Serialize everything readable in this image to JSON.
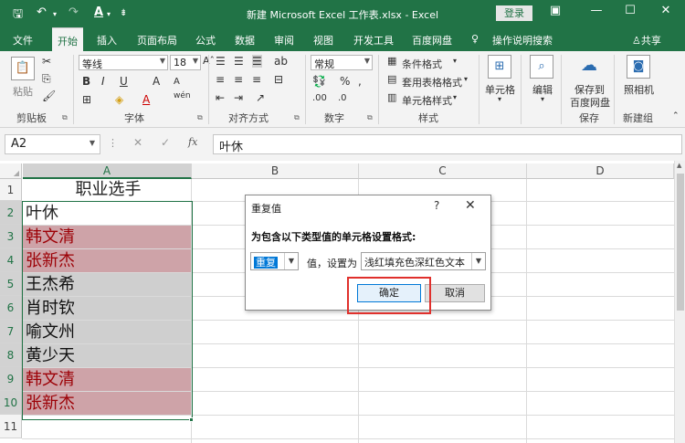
{
  "titlebar": {
    "title": "新建 Microsoft Excel 工作表.xlsx - Excel",
    "login": "登录",
    "save_icon": "save-icon",
    "undo_icon": "undo-icon",
    "redo_icon": "redo-icon",
    "font_color_quick_icon": "font-color-icon"
  },
  "menu_tabs": [
    "文件",
    "开始",
    "插入",
    "页面布局",
    "公式",
    "数据",
    "审阅",
    "视图",
    "开发工具",
    "百度网盘"
  ],
  "tellme": "操作说明搜索",
  "share": "共享",
  "ribbon": {
    "clipboard": {
      "label": "剪贴板",
      "paste": "粘贴"
    },
    "font": {
      "label": "字体",
      "font_name": "等线",
      "font_size": "18",
      "bold": "B",
      "italic": "I",
      "underline": "U",
      "wen": "wén"
    },
    "alignment": {
      "label": "对齐方式"
    },
    "number": {
      "label": "数字",
      "format": "常规"
    },
    "styles": {
      "label": "样式",
      "conditional": "条件格式",
      "table": "套用表格格式",
      "cell": "单元格样式"
    },
    "cells": {
      "label": "单元格"
    },
    "editing": {
      "label": "编辑"
    },
    "save": {
      "label": "保存",
      "button_line1": "保存到",
      "button_line2": "百度网盘"
    },
    "newgroup": {
      "label": "新建组",
      "camera": "照相机"
    }
  },
  "formula_bar": {
    "name_box": "A2",
    "fx": "fx",
    "value": "叶休"
  },
  "columns": [
    "A",
    "B",
    "C",
    "D"
  ],
  "rows": [
    {
      "num": "1",
      "value": "职业选手",
      "style": "header"
    },
    {
      "num": "2",
      "value": "叶休",
      "style": "plain"
    },
    {
      "num": "3",
      "value": "韩文清",
      "style": "red"
    },
    {
      "num": "4",
      "value": "张新杰",
      "style": "red"
    },
    {
      "num": "5",
      "value": "王杰希",
      "style": "gray"
    },
    {
      "num": "6",
      "value": "肖时钦",
      "style": "gray"
    },
    {
      "num": "7",
      "value": "喻文州",
      "style": "gray"
    },
    {
      "num": "8",
      "value": "黄少天",
      "style": "gray"
    },
    {
      "num": "9",
      "value": "韩文清",
      "style": "red"
    },
    {
      "num": "10",
      "value": "张新杰",
      "style": "red"
    },
    {
      "num": "11",
      "value": "",
      "style": "plain"
    }
  ],
  "dialog": {
    "title": "重复值",
    "help": "?",
    "close": "✕",
    "prompt": "为包含以下类型值的单元格设置格式:",
    "type_value": "重复",
    "value_label": "值，设置为",
    "format_value": "浅红填充色深红色文本",
    "ok": "确定",
    "cancel": "取消"
  },
  "colors": {
    "excel_green": "#217346",
    "dup_fill": "#cea3a8",
    "dup_text": "#9c0006",
    "gray_fill": "#cfcfcf",
    "highlight_box": "#e0302c"
  }
}
